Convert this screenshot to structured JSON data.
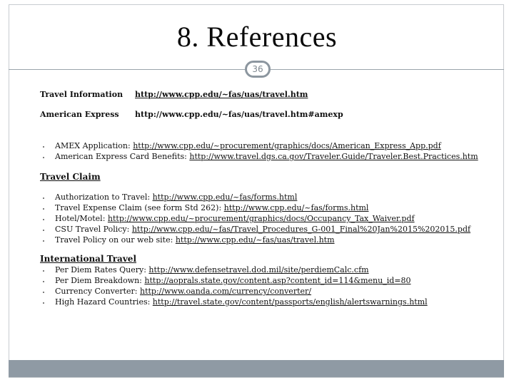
{
  "slide": {
    "title": "8.  References",
    "page_number": "36"
  },
  "top_links": [
    {
      "label": "Travel Information",
      "url": "http://www.cpp.edu/~fas/uas/travel.htm"
    },
    {
      "label": "American Express",
      "url": "http://www.cpp.edu/~fas/uas/travel.htm#amexp"
    }
  ],
  "amex_items": [
    {
      "text": "AMEX Application: ",
      "url": "http://www.cpp.edu/~procurement/graphics/docs/American_Express_App.pdf"
    },
    {
      "text": "American Express Card Benefits: ",
      "url": "http://www.travel.dgs.ca.gov/Traveler.Guide/Traveler.Best.Practices.htm"
    }
  ],
  "travel_claim": {
    "heading": "Travel Claim",
    "items": [
      {
        "text": "Authorization to Travel: ",
        "url": "http://www.cpp.edu/~fas/forms.html"
      },
      {
        "text": "Travel Expense Claim (see form Std 262): ",
        "url": "http://www.cpp.edu/~fas/forms.html"
      },
      {
        "text": "Hotel/Motel: ",
        "url": "http://www.cpp.edu/~procurement/graphics/docs/Occupancy_Tax_Waiver.pdf"
      },
      {
        "text": "CSU Travel Policy: ",
        "url": "http://www.cpp.edu/~fas/Travel_Procedures_G-001_Final%20Jan%2015%202015.pdf"
      },
      {
        "text": "Travel Policy on our web site: ",
        "url": "http://www.cpp.edu/~fas/uas/travel.htm"
      }
    ]
  },
  "international_travel": {
    "heading": "International Travel",
    "items": [
      {
        "text": "Per Diem Rates Query: ",
        "url": "http://www.defensetravel.dod.mil/site/perdiemCalc.cfm"
      },
      {
        "text": "Per Diem Breakdown: ",
        "url": "http://aoprals.state.gov/content.asp?content_id=114&menu_id=80"
      },
      {
        "text": "Currency Converter: ",
        "url": "http://www.oanda.com/currency/converter/"
      },
      {
        "text": "High Hazard Countries: ",
        "url": "http://travel.state.gov/content/passports/english/alertswarnings.html"
      }
    ]
  },
  "colors": {
    "frame": "#c8ccd0",
    "badge": "#8c969f",
    "bottom_bar": "#8f9aa4"
  }
}
